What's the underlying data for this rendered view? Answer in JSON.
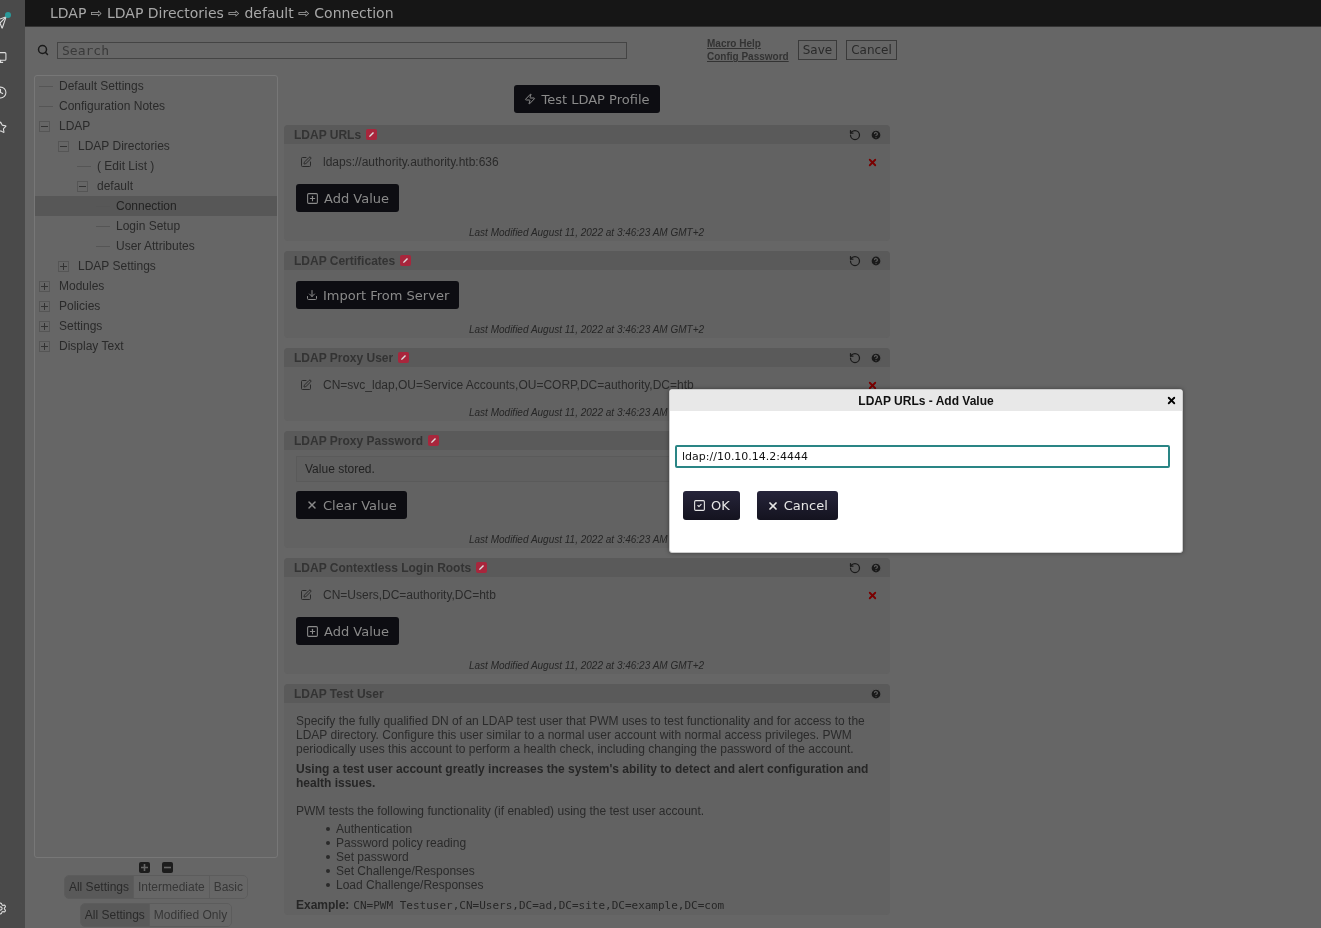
{
  "breadcrumb": "LDAP ⇨ LDAP Directories ⇨ default ⇨ Connection",
  "search": {
    "placeholder": "Search"
  },
  "links": [
    "Macro Help",
    "Config Password"
  ],
  "top_buttons": [
    "Save",
    "Cancel"
  ],
  "tree": [
    {
      "label": "Default Settings",
      "selected": false
    },
    {
      "label": "Configuration Notes",
      "selected": false
    },
    {
      "label": "LDAP",
      "selected": false,
      "expanded": true,
      "children": [
        {
          "label": "LDAP Directories",
          "selected": false,
          "expanded": true,
          "children": [
            {
              "label": "( Edit List )",
              "selected": false
            },
            {
              "label": "default",
              "selected": false,
              "expanded": true,
              "children": [
                {
                  "label": "Connection",
                  "selected": true
                },
                {
                  "label": "Login Setup",
                  "selected": false
                },
                {
                  "label": "User Attributes",
                  "selected": false
                }
              ]
            }
          ]
        },
        {
          "label": "LDAP Settings",
          "selected": false,
          "expanded": false
        }
      ]
    },
    {
      "label": "Modules",
      "selected": false,
      "expanded": false
    },
    {
      "label": "Policies",
      "selected": false,
      "expanded": false
    },
    {
      "label": "Settings",
      "selected": false,
      "expanded": false
    },
    {
      "label": "Display Text",
      "selected": false,
      "expanded": false
    }
  ],
  "filters": [
    [
      {
        "label": "All Settings",
        "selected": true
      },
      {
        "label": "Intermediate",
        "selected": false
      },
      {
        "label": "Basic",
        "selected": false
      }
    ],
    [
      {
        "label": "All Settings",
        "selected": true
      },
      {
        "label": "Modified Only",
        "selected": false
      }
    ]
  ],
  "test_button": "Test LDAP Profile",
  "settings": [
    {
      "kind": "value_list",
      "title": "LDAP URLs",
      "modified_badge": true,
      "reset": true,
      "help": true,
      "values": [
        "ldaps://authority.authority.htb:636"
      ],
      "button": "Add Value",
      "modified": "Last Modified August 11, 2022 at 3:46:23 AM GMT+2"
    },
    {
      "kind": "import",
      "title": "LDAP Certificates",
      "modified_badge": true,
      "reset": true,
      "help": true,
      "button": "Import From Server",
      "modified": "Last Modified August 11, 2022 at 3:46:23 AM GMT+2"
    },
    {
      "kind": "value_list",
      "title": "LDAP Proxy User",
      "modified_badge": true,
      "reset": true,
      "help": true,
      "values": [
        "CN=svc_ldap,OU=Service Accounts,OU=CORP,DC=authority,DC=htb"
      ],
      "modified": "Last Modified August 11, 2022 at 3:46:23 AM"
    },
    {
      "kind": "stored",
      "title": "LDAP Proxy Password",
      "modified_badge": true,
      "value": "Value stored.",
      "button": "Clear Value",
      "modified": "Last Modified August 11, 2022 at 3:46:23 AM"
    },
    {
      "kind": "value_list",
      "title": "LDAP Contextless Login Roots",
      "modified_badge": true,
      "reset": true,
      "help": true,
      "values": [
        "CN=Users,DC=authority,DC=htb"
      ],
      "button": "Add Value",
      "modified": "Last Modified August 11, 2022 at 3:46:23 AM GMT+2"
    },
    {
      "kind": "description",
      "title": "LDAP Test User",
      "modified_badge": false,
      "help": true,
      "paragraphs": [
        "Specify the fully qualified DN of an LDAP test user that PWM uses to test functionality and for access to the LDAP directory. Configure this user similar to a normal user account with normal access privileges. PWM periodically uses this account to perform a health check, including changing the password of the account."
      ],
      "notice": "Using a test user account greatly increases the system's ability to detect and alert configuration and health issues.",
      "list_intro": "PWM tests the following functionality (if enabled) using the test user account.",
      "items": [
        "Authentication",
        "Password policy reading",
        "Set password",
        "Set Challenge/Responses",
        "Load Challenge/Responses"
      ],
      "example": {
        "label": "Example:",
        "value": "CN=PWM Testuser,CN=Users,DC=ad,DC=site,DC=example,DC=com"
      }
    }
  ],
  "dialog": {
    "title": "LDAP URLs - Add Value",
    "value": "ldap://10.10.14.2:4444",
    "buttons": [
      {
        "kind": "ok",
        "label": "OK"
      },
      {
        "kind": "cancel",
        "label": "Cancel"
      }
    ]
  }
}
